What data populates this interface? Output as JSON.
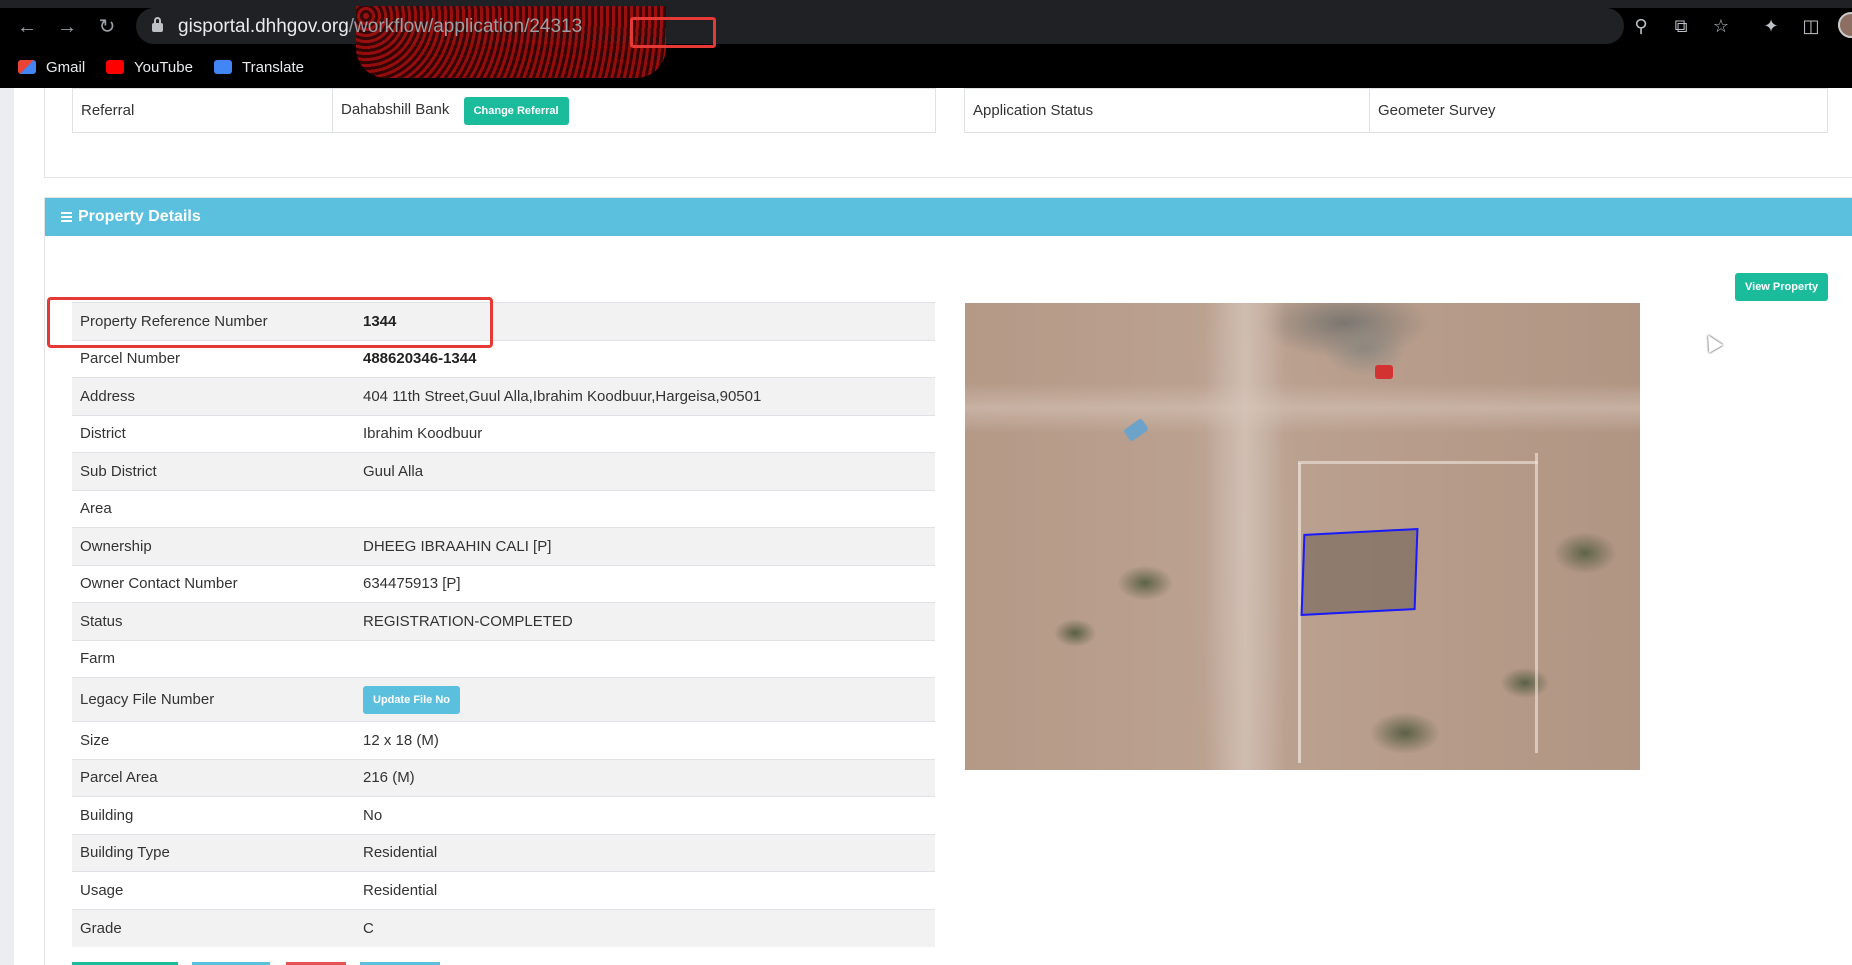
{
  "browser": {
    "url_host": "gisportal.dhhgov.org",
    "url_path": "/workflow/application/24313",
    "bookmarks": [
      {
        "label": "Gmail",
        "icon": "gmail-icon"
      },
      {
        "label": "YouTube",
        "icon": "youtube-icon"
      },
      {
        "label": "Translate",
        "icon": "translate-icon"
      }
    ]
  },
  "top_section": {
    "referral_label": "Referral",
    "referral_value": "Dahabshill Bank",
    "change_referral_label": "Change Referral",
    "application_status_label": "Application Status",
    "application_status_value": "Geometer Survey"
  },
  "property": {
    "section_title": "Property Details",
    "view_property_label": "View Property",
    "rows": [
      {
        "key": "Property Reference Number",
        "value": "1344",
        "bold": true
      },
      {
        "key": "Parcel Number",
        "value": "488620346-1344",
        "bold": true
      },
      {
        "key": "Address",
        "value": "404 11th Street,Guul Alla,Ibrahim Koodbuur,Hargeisa,90501"
      },
      {
        "key": "District",
        "value": "Ibrahim Koodbuur"
      },
      {
        "key": "Sub District",
        "value": "Guul Alla"
      },
      {
        "key": "Area",
        "value": ""
      },
      {
        "key": "Ownership",
        "value": "DHEEG IBRAAHIN CALI [P]"
      },
      {
        "key": "Owner Contact Number",
        "value": "634475913 [P]"
      },
      {
        "key": "Status",
        "value": "REGISTRATION-COMPLETED"
      },
      {
        "key": "Farm",
        "value": ""
      },
      {
        "key": "Legacy File Number",
        "button": "Update File No"
      },
      {
        "key": "Size",
        "value": "12 x 18 (M)"
      },
      {
        "key": "Parcel Area",
        "value": "216 (M)"
      },
      {
        "key": "Building",
        "value": "No"
      },
      {
        "key": "Building Type",
        "value": "Residential"
      },
      {
        "key": "Usage",
        "value": "Residential"
      },
      {
        "key": "Grade",
        "value": "C"
      }
    ]
  },
  "colors": {
    "header_blue": "#5bc0de",
    "button_green": "#1abc9c",
    "highlight_red": "#e53935",
    "parcel_outline": "#1a1aff"
  }
}
